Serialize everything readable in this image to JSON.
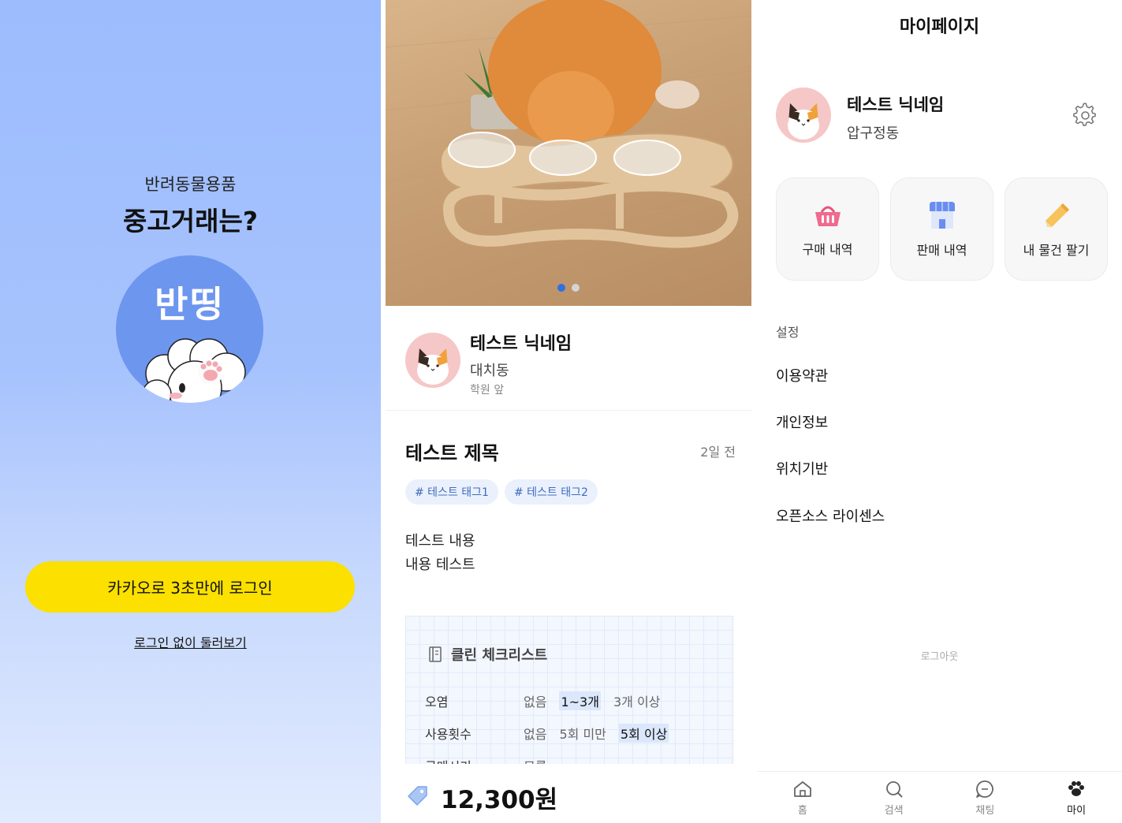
{
  "login": {
    "subtitle": "반려동물용품",
    "headline": "중고거래는?",
    "logo_text": "반띵",
    "kakao_button": "카카오로 3초만에 로그인",
    "browse_link": "로그인 없이 둘러보기"
  },
  "detail": {
    "image_indicator": {
      "total": 2,
      "current": 1
    },
    "seller": {
      "nickname": "테스트 닉네임",
      "location": "대치동",
      "location_detail": "학원 앞"
    },
    "title": "테스트 제목",
    "time_ago": "2일 전",
    "tags": [
      "# 테스트 태그1",
      "# 테스트 태그2"
    ],
    "content_lines": [
      "테스트 내용",
      "내용 테스트"
    ],
    "checklist": {
      "title": "클린 체크리스트",
      "rows": [
        {
          "label": "오염",
          "options": [
            "없음",
            "1~3개",
            "3개 이상"
          ],
          "selected": 1
        },
        {
          "label": "사용횟수",
          "options": [
            "없음",
            "5회 미만",
            "5회 이상"
          ],
          "selected": 2
        },
        {
          "label": "구매시기",
          "options": [
            "모름"
          ],
          "selected": -1
        }
      ]
    },
    "price": "12,300원"
  },
  "mypage": {
    "title": "마이페이지",
    "profile": {
      "nickname": "테스트 닉네임",
      "location": "압구정동"
    },
    "cards": [
      {
        "label": "구매 내역",
        "icon": "basket-icon"
      },
      {
        "label": "판매 내역",
        "icon": "store-icon"
      },
      {
        "label": "내 물건 팔기",
        "icon": "pencil-icon"
      }
    ],
    "settings_label": "설정",
    "menu": [
      "이용약관",
      "개인정보",
      "위치기반",
      "오픈소스 라이센스"
    ],
    "logout": "로그아웃",
    "tabs": [
      {
        "label": "홈",
        "icon": "home-icon"
      },
      {
        "label": "검색",
        "icon": "search-icon"
      },
      {
        "label": "채팅",
        "icon": "chat-icon"
      },
      {
        "label": "마이",
        "icon": "paw-icon",
        "active": true
      }
    ]
  },
  "colors": {
    "login_bg": "#9cbcfd",
    "kakao_yellow": "#fbe000",
    "accent_blue": "#2f6fe4",
    "tag_bg": "#eaf1fd",
    "avatar_bg": "#f6c7c7"
  }
}
